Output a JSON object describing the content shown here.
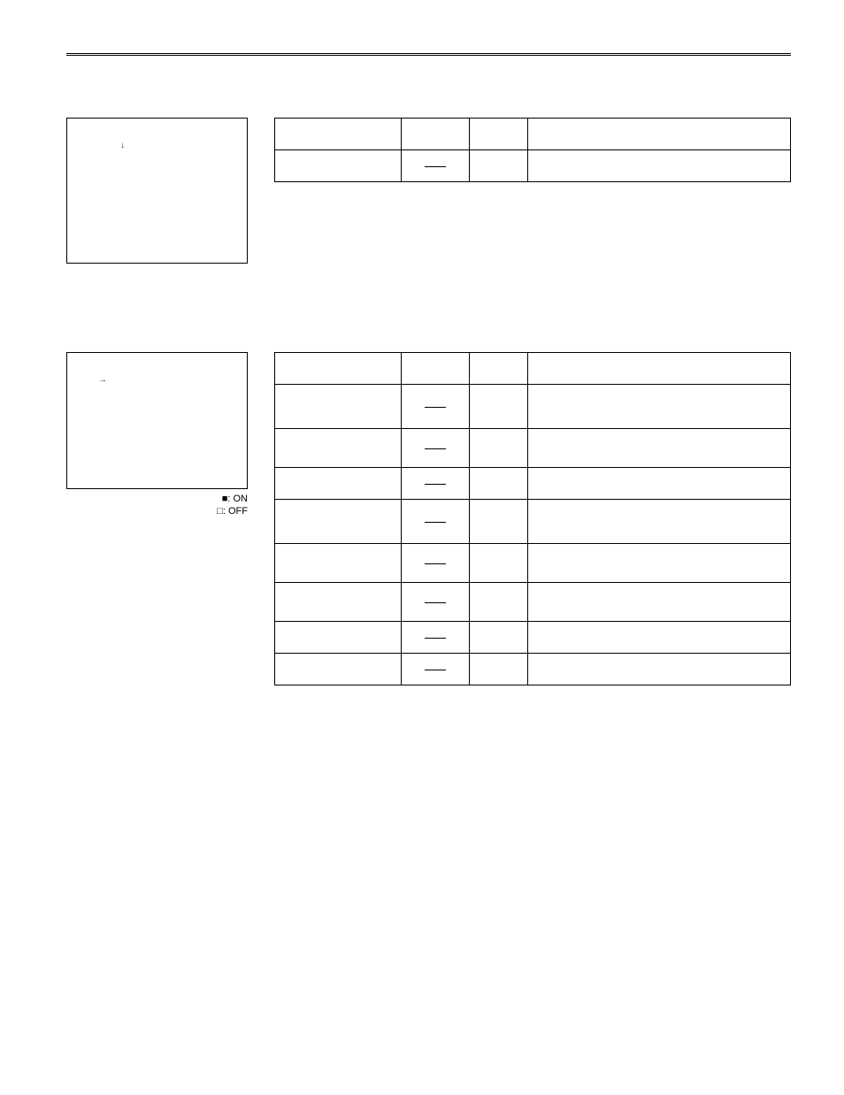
{
  "legend": {
    "on": "■: ON",
    "off": "□: OFF"
  },
  "table1": {
    "headers": [
      "",
      "",
      "",
      ""
    ],
    "rows": [
      {
        "c1": "",
        "c2_dash": true,
        "c3": "",
        "c4": ""
      }
    ]
  },
  "table2": {
    "headers": [
      "",
      "",
      "",
      ""
    ],
    "rows": [
      {
        "c1": "",
        "c2_dash": true,
        "c3": "",
        "c4": ""
      },
      {
        "c1": "",
        "c2_dash": true,
        "c3": "",
        "c4": ""
      },
      {
        "c1": "",
        "c2_dash": true,
        "c3": "",
        "c4": ""
      },
      {
        "c1": "",
        "c2_dash": true,
        "c3": "",
        "c4": ""
      },
      {
        "c1": "",
        "c2_dash": true,
        "c3": "",
        "c4": ""
      },
      {
        "c1": "",
        "c2_dash": true,
        "c3": "",
        "c4": ""
      },
      {
        "c1": "",
        "c2_dash": true,
        "c3": "",
        "c4": ""
      },
      {
        "c1": "",
        "c2_dash": true,
        "c3": "",
        "c4": "",
        "dashed": true
      }
    ]
  }
}
